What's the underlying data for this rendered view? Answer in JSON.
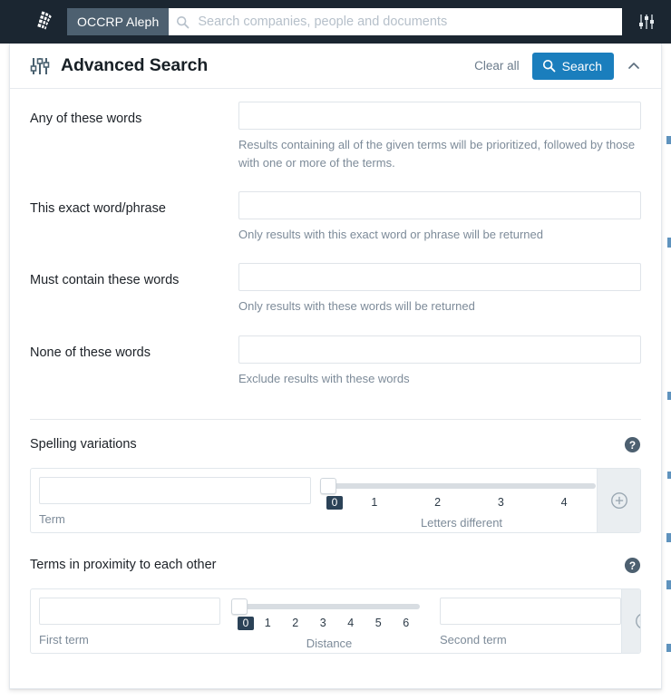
{
  "navbar": {
    "brand_label": "OCCRP Aleph",
    "search_placeholder": "Search companies, people and documents",
    "search_value": "",
    "logo_name": "aleph-globe-logo",
    "sliders_icon_name": "sliders-icon"
  },
  "panel": {
    "title": "Advanced Search",
    "clear_all_label": "Clear all",
    "search_button_label": "Search",
    "collapse_icon": "chevron-up-icon"
  },
  "fields": [
    {
      "label": "Any of these words",
      "value": "",
      "placeholder": "",
      "helper": "Results containing all of the given terms will be prioritized, followed by those with one or more of the terms."
    },
    {
      "label": "This exact word/phrase",
      "value": "",
      "placeholder": "",
      "helper": "Only results with this exact word or phrase will be returned"
    },
    {
      "label": "Must contain these words",
      "value": "",
      "placeholder": "",
      "helper": "Only results with these words will be returned"
    },
    {
      "label": "None of these words",
      "value": "",
      "placeholder": "",
      "helper": "Exclude results with these words"
    }
  ],
  "spelling": {
    "title": "Spelling variations",
    "term_value": "",
    "term_label": "Term",
    "slider_label": "Letters different",
    "slider_value": 0,
    "ticks": [
      "0",
      "1",
      "2",
      "3",
      "4"
    ],
    "add_label": "add"
  },
  "proximity": {
    "title": "Terms in proximity to each other",
    "first_term_value": "",
    "first_term_label": "First term",
    "second_term_value": "",
    "second_term_label": "Second term",
    "slider_label": "Distance",
    "slider_value": 0,
    "ticks": [
      "0",
      "1",
      "2",
      "3",
      "4",
      "5",
      "6"
    ],
    "add_label": "add"
  },
  "colors": {
    "navbar_bg": "#1b2631",
    "brand_tag_bg": "#4d6070",
    "accent_blue": "#1a7ebd",
    "slider_badge": "#2b4257",
    "helper_text": "#7d8b99"
  }
}
